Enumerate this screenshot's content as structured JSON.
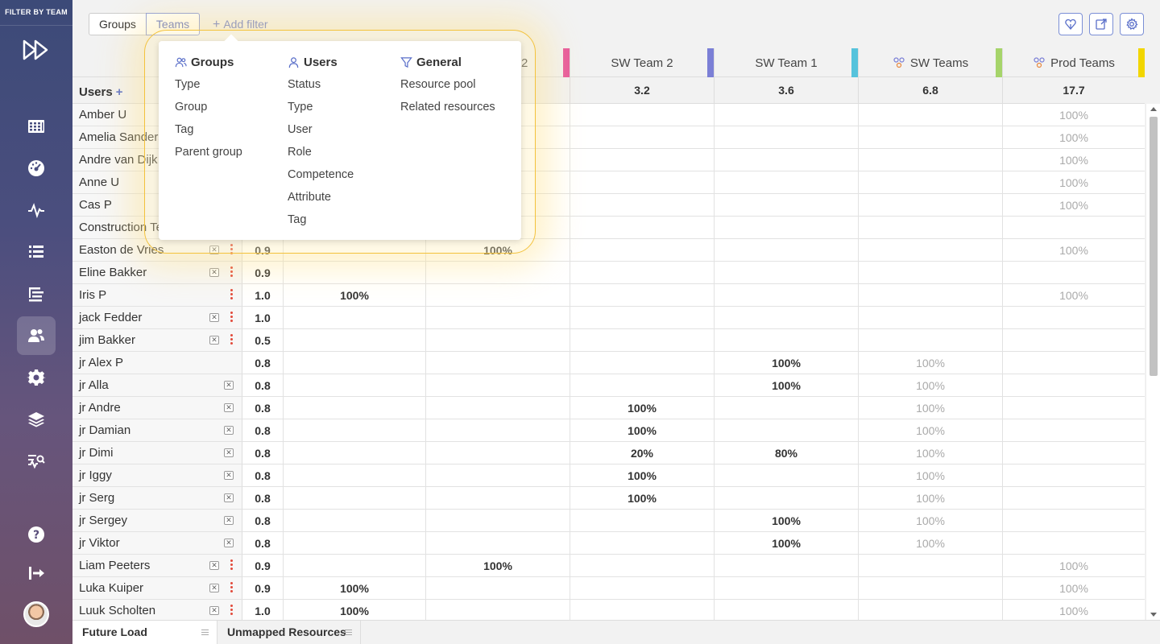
{
  "sidebar": {
    "title": "FILTER BY TEAM",
    "items": [
      {
        "icon": "grid-icon"
      },
      {
        "icon": "dashboard-icon"
      },
      {
        "icon": "activity-icon"
      },
      {
        "icon": "list-icon"
      },
      {
        "icon": "tree-list-icon"
      },
      {
        "icon": "users-icon",
        "active": true
      },
      {
        "icon": "gear-icon"
      },
      {
        "icon": "layers-icon"
      },
      {
        "icon": "search-activity-icon"
      },
      {
        "icon": "help-icon"
      },
      {
        "icon": "logout-icon"
      }
    ]
  },
  "toolbar": {
    "tabs": [
      "Groups",
      "Teams"
    ],
    "selected_tab": "Teams",
    "add_filter": "Add filter"
  },
  "columns": [
    {
      "label": "SW Team 2",
      "total": "3.2",
      "bar_color": "#7b7fd6"
    },
    {
      "label": "SW Team 1",
      "total": "3.6",
      "bar_color": "#56c3dc"
    },
    {
      "label": "SW Teams",
      "total": "6.8",
      "bar_color": "#a6d46a"
    },
    {
      "label": "Prod Teams",
      "total": "17.7",
      "bar_color": "#f2d600"
    }
  ],
  "hidden_columns": {
    "col2_header_fragment": "2",
    "col1_bar_color": "#e75a9c"
  },
  "users_header": "Users",
  "rows": [
    {
      "name": "Amber U",
      "c": [
        "",
        "",
        "",
        "",
        "",
        "100%m"
      ]
    },
    {
      "name": "Amelia Sanders",
      "c": [
        "",
        "",
        "",
        "",
        "",
        "100%m"
      ]
    },
    {
      "name": "Andre van Dijk",
      "c": [
        "",
        "",
        "",
        "",
        "",
        "100%m"
      ]
    },
    {
      "name": "Anne U",
      "c": [
        "",
        "",
        "",
        "",
        "",
        "100%m"
      ]
    },
    {
      "name": "Cas P",
      "c": [
        "",
        "",
        "",
        "",
        "",
        "100%m"
      ]
    },
    {
      "name": "Construction Te",
      "c": [
        "",
        "",
        "",
        "",
        "",
        ""
      ]
    },
    {
      "name": "Easton de Vries",
      "fte": "0.9",
      "x": true,
      "kebab": true,
      "c": [
        "",
        "100%",
        "",
        "",
        "",
        "100%m"
      ]
    },
    {
      "name": "Eline Bakker",
      "fte": "0.9",
      "x": true,
      "kebab": true,
      "c": [
        "",
        "",
        "",
        "",
        "",
        ""
      ]
    },
    {
      "name": "Iris P",
      "fte": "1.0",
      "kebab": true,
      "c": [
        "100%",
        "",
        "",
        "",
        "",
        "100%m"
      ]
    },
    {
      "name": "jack Fedder",
      "fte": "1.0",
      "x": true,
      "kebab": true,
      "c": [
        "",
        "",
        "",
        "",
        "",
        ""
      ]
    },
    {
      "name": "jim Bakker",
      "fte": "0.5",
      "x": true,
      "kebab": true,
      "c": [
        "",
        "",
        "",
        "",
        "",
        ""
      ]
    },
    {
      "name": "jr Alex P",
      "fte": "0.8",
      "c": [
        "",
        "",
        "",
        "100%",
        "100%m",
        ""
      ]
    },
    {
      "name": "jr Alla",
      "fte": "0.8",
      "x2": true,
      "c": [
        "",
        "",
        "",
        "100%",
        "100%m",
        ""
      ]
    },
    {
      "name": "jr Andre",
      "fte": "0.8",
      "x2": true,
      "c": [
        "",
        "",
        "100%",
        "",
        "100%m",
        ""
      ]
    },
    {
      "name": "jr Damian",
      "fte": "0.8",
      "x2": true,
      "c": [
        "",
        "",
        "100%",
        "",
        "100%m",
        ""
      ]
    },
    {
      "name": "jr Dimi",
      "fte": "0.8",
      "x2": true,
      "c": [
        "",
        "",
        "20%",
        "80%",
        "100%m",
        ""
      ]
    },
    {
      "name": "jr Iggy",
      "fte": "0.8",
      "x2": true,
      "c": [
        "",
        "",
        "100%",
        "",
        "100%m",
        ""
      ]
    },
    {
      "name": "jr Serg",
      "fte": "0.8",
      "x2": true,
      "c": [
        "",
        "",
        "100%",
        "",
        "100%m",
        ""
      ]
    },
    {
      "name": "jr Sergey",
      "fte": "0.8",
      "x2": true,
      "c": [
        "",
        "",
        "",
        "100%",
        "100%m",
        ""
      ]
    },
    {
      "name": "jr Viktor",
      "fte": "0.8",
      "x2": true,
      "c": [
        "",
        "",
        "",
        "100%",
        "100%m",
        ""
      ]
    },
    {
      "name": "Liam Peeters",
      "fte": "0.9",
      "x": true,
      "kebab": true,
      "c": [
        "",
        "100%",
        "",
        "",
        "",
        "100%m"
      ]
    },
    {
      "name": "Luka Kuiper",
      "fte": "0.9",
      "x": true,
      "kebab": true,
      "c": [
        "100%",
        "",
        "",
        "",
        "",
        "100%m"
      ]
    },
    {
      "name": "Luuk Scholten",
      "fte": "1.0",
      "x": true,
      "kebab": true,
      "c": [
        "100%",
        "",
        "",
        "",
        "",
        "100%m"
      ]
    }
  ],
  "bottom_tabs": [
    "Future Load",
    "Unmapped Resources"
  ],
  "popup": {
    "groups": {
      "title": "Groups",
      "items": [
        "Type",
        "Group",
        "Tag",
        "Parent group"
      ]
    },
    "users": {
      "title": "Users",
      "items": [
        "Status",
        "Type",
        "User",
        "Role",
        "Competence",
        "Attribute",
        "Tag"
      ]
    },
    "general": {
      "title": "General",
      "items": [
        "Resource pool",
        "Related resources"
      ]
    }
  }
}
